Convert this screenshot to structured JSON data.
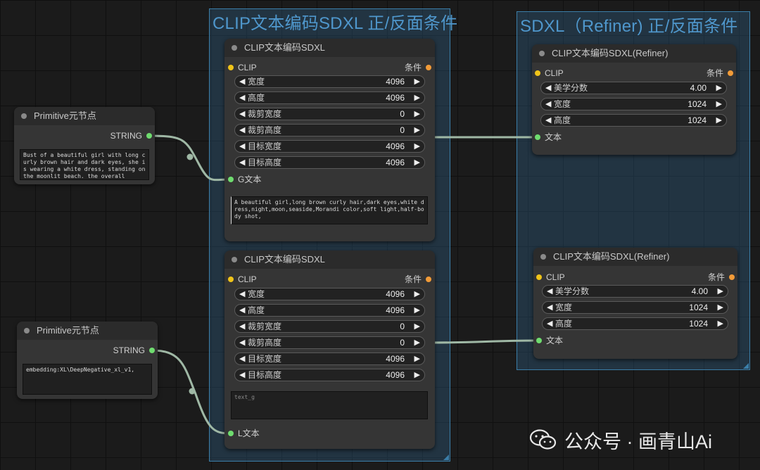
{
  "groups": {
    "left_title": "CLIP文本编码SDXL  正/反面条件",
    "right_title": "SDXL（Refiner)   正/反面条件"
  },
  "primitive_top": {
    "title": "Primitive元节点",
    "output": "STRING",
    "text": "Bust of a beautiful girl with long curly brown hair and dark eyes, she is wearing a white dress, standing on the moonlit beach. the overall"
  },
  "primitive_bottom": {
    "title": "Primitive元节点",
    "output": "STRING",
    "text": "embedding:XL\\DeepNegative_xl_v1,"
  },
  "clip_top": {
    "title": "CLIP文本编码SDXL",
    "input_clip": "CLIP",
    "output": "条件",
    "widgets": [
      {
        "label": "宽度",
        "value": "4096"
      },
      {
        "label": "高度",
        "value": "4096"
      },
      {
        "label": "裁剪宽度",
        "value": "0"
      },
      {
        "label": "裁剪高度",
        "value": "0"
      },
      {
        "label": "目标宽度",
        "value": "4096"
      },
      {
        "label": "目标高度",
        "value": "4096"
      }
    ],
    "text_input": "G文本",
    "text": "A beautiful girl,long brown curly hair,dark eyes,white dress,night,moon,seaside,Morandi color,soft light,half-body shot,"
  },
  "clip_bottom": {
    "title": "CLIP文本编码SDXL",
    "input_clip": "CLIP",
    "output": "条件",
    "widgets": [
      {
        "label": "宽度",
        "value": "4096"
      },
      {
        "label": "高度",
        "value": "4096"
      },
      {
        "label": "裁剪宽度",
        "value": "0"
      },
      {
        "label": "裁剪高度",
        "value": "0"
      },
      {
        "label": "目标宽度",
        "value": "4096"
      },
      {
        "label": "目标高度",
        "value": "4096"
      }
    ],
    "text_placeholder": "text_g",
    "text_input": "L文本"
  },
  "refiner_top": {
    "title": "CLIP文本编码SDXL(Refiner)",
    "input_clip": "CLIP",
    "output": "条件",
    "widgets": [
      {
        "label": "美学分数",
        "value": "4.00"
      },
      {
        "label": "宽度",
        "value": "1024"
      },
      {
        "label": "高度",
        "value": "1024"
      }
    ],
    "text_input": "文本"
  },
  "refiner_bottom": {
    "title": "CLIP文本编码SDXL(Refiner)",
    "input_clip": "CLIP",
    "output": "条件",
    "widgets": [
      {
        "label": "美学分数",
        "value": "4.00"
      },
      {
        "label": "宽度",
        "value": "1024"
      },
      {
        "label": "高度",
        "value": "1024"
      }
    ],
    "text_input": "文本"
  },
  "watermark": {
    "text": "公众号 · 画青山Ai",
    "icon": "wechat-icon"
  },
  "colors": {
    "clip_slot": "#f0c419",
    "cond_slot": "#f29b38",
    "string_slot": "#6fdc6f",
    "link": "#9fb8a5",
    "group_title": "#4f97cc"
  }
}
